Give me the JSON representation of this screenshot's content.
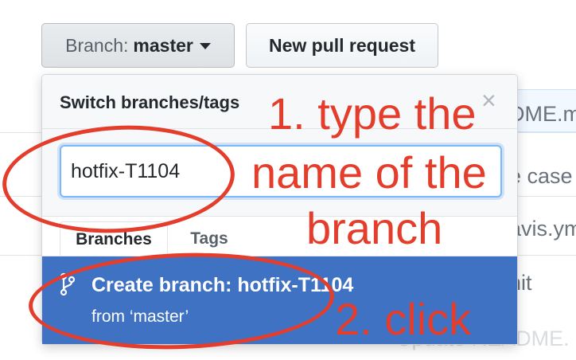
{
  "toolbar": {
    "branch_prefix": "Branch:",
    "branch_name": "master",
    "new_pr_label": "New pull request"
  },
  "background": {
    "fragments": [
      "DME.m",
      "e case",
      "avis.ym",
      "nit",
      "README.",
      "Update README."
    ]
  },
  "dropdown": {
    "title": "Switch branches/tags",
    "close_glyph": "×",
    "filter_value": "hotfix-T1104",
    "tabs": [
      "Branches",
      "Tags"
    ],
    "create_label": "Create branch: hotfix-T1104",
    "create_from": "from ‘master’"
  },
  "annotations": {
    "line1": "1. type the",
    "line2": "name of the",
    "line3": "branch",
    "line4": "2. click",
    "color": "#e43d2b"
  },
  "colors": {
    "accent": "#4072c4",
    "annotation": "#e43d2b"
  }
}
